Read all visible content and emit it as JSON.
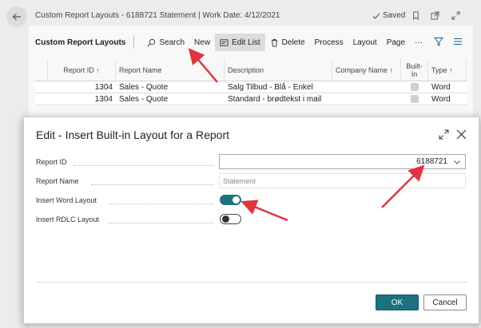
{
  "header": {
    "title": "Custom Report Layouts - 6188721 Statement | Work Date: 4/12/2021",
    "saved_label": "Saved"
  },
  "action_bar": {
    "list_name": "Custom Report Layouts",
    "actions": [
      "Search",
      "New",
      "Edit List",
      "Delete",
      "Process",
      "Layout",
      "Page"
    ],
    "more": "···"
  },
  "table": {
    "columns": [
      "Report ID ↑",
      "Report Name",
      "Description",
      "Company Name ↑",
      "Built-In",
      "Type ↑"
    ],
    "rows": [
      {
        "report_id": "1304",
        "report_name": "Sales - Quote",
        "description": "Salg Tilbud - Blå - Enkel",
        "company": "",
        "type": "Word"
      },
      {
        "report_id": "1304",
        "report_name": "Sales - Quote",
        "description": "Standard - brødtekst i mail",
        "company": "",
        "type": "Word"
      }
    ]
  },
  "dialog": {
    "title": "Edit - Insert Built-in Layout for a Report",
    "fields": {
      "report_id": {
        "label": "Report ID",
        "value": "6188721"
      },
      "report_name": {
        "label": "Report Name",
        "value": "Statement"
      },
      "insert_word": {
        "label": "Insert Word Layout",
        "on": true
      },
      "insert_rdlc": {
        "label": "Insert RDLC Layout",
        "on": false
      }
    },
    "ok_label": "OK",
    "cancel_label": "Cancel"
  },
  "colors": {
    "accent": "#1d7181",
    "annotation_arrow": "#e0353f"
  }
}
